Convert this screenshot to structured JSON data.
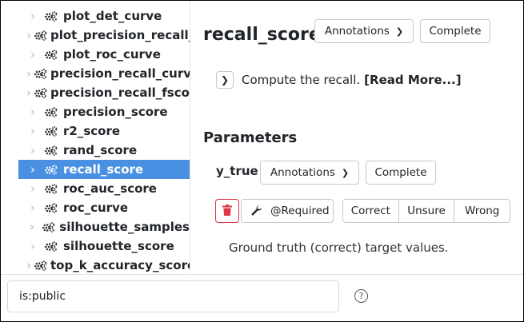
{
  "sidebar": {
    "items": [
      {
        "label": "plot_det_curve"
      },
      {
        "label": "plot_precision_recall_curve"
      },
      {
        "label": "plot_roc_curve"
      },
      {
        "label": "precision_recall_curve"
      },
      {
        "label": "precision_recall_fscore_support"
      },
      {
        "label": "precision_score"
      },
      {
        "label": "r2_score"
      },
      {
        "label": "rand_score"
      },
      {
        "label": "recall_score",
        "selected": true
      },
      {
        "label": "roc_auc_score"
      },
      {
        "label": "roc_curve"
      },
      {
        "label": "silhouette_samples"
      },
      {
        "label": "silhouette_score"
      },
      {
        "label": "top_k_accuracy_score"
      }
    ]
  },
  "main": {
    "title": "recall_score",
    "annotations_label": "Annotations",
    "complete_label": "Complete",
    "summary_text": "Compute the recall.",
    "read_more_label": "[Read More...]",
    "parameters_title": "Parameters",
    "parameter": {
      "name": "y_true",
      "annotations_label": "Annotations",
      "complete_label": "Complete",
      "required_label": "@Required",
      "status_options": [
        "Correct",
        "Unsure",
        "Wrong"
      ],
      "description": "Ground truth (correct) target values."
    }
  },
  "search": {
    "value": "is:public",
    "help_label": "?"
  },
  "colors": {
    "selected_bg": "#4a90e2",
    "delete_red": "#dc3545"
  }
}
